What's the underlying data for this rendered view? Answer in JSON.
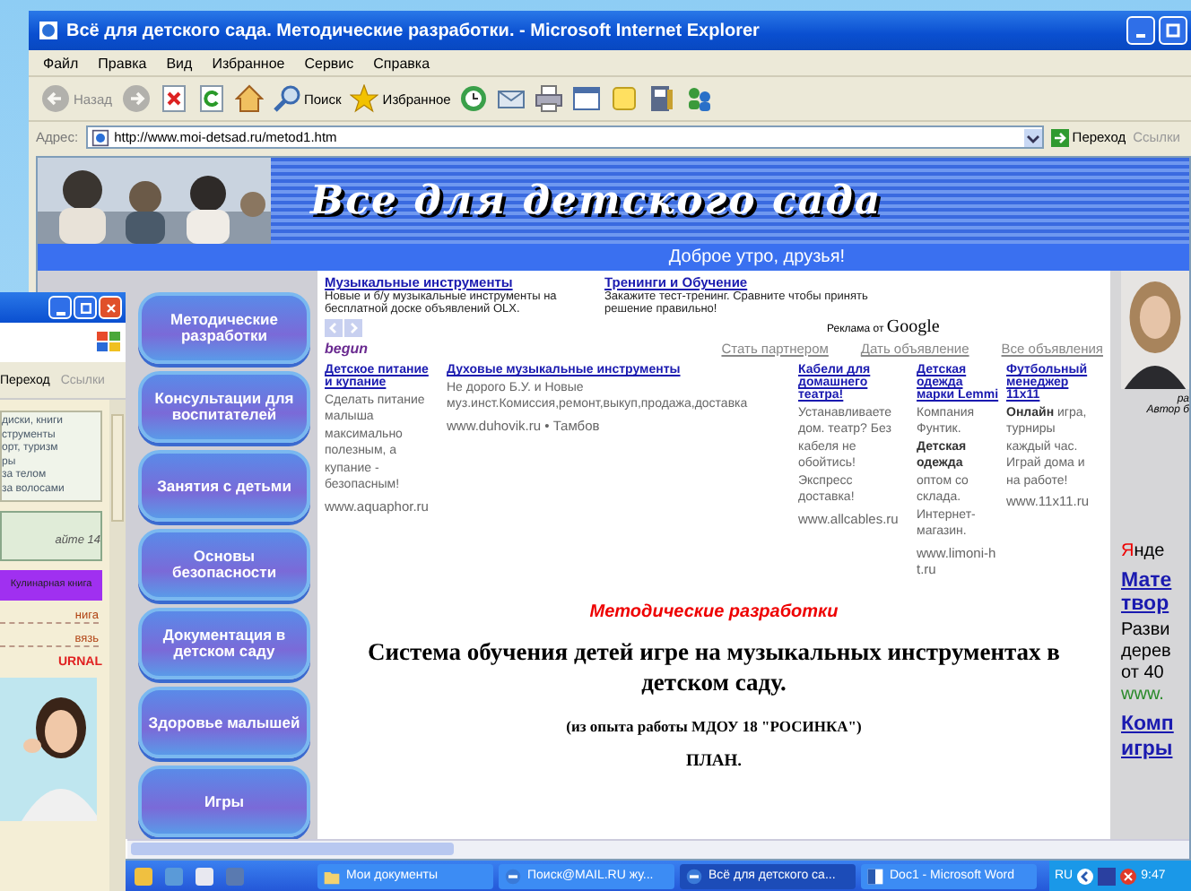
{
  "main_window": {
    "title": "Всё для детского сада. Методические разработки. - Microsoft Internet Explorer",
    "menu": [
      "Файл",
      "Правка",
      "Вид",
      "Избранное",
      "Сервис",
      "Справка"
    ],
    "toolbar": [
      {
        "kind": "back",
        "label": "Назад",
        "disabled": true
      },
      {
        "kind": "forward",
        "disabled": true
      },
      {
        "kind": "stop",
        "disabled": false
      },
      {
        "kind": "refresh",
        "disabled": false
      },
      {
        "kind": "home",
        "disabled": false
      },
      {
        "kind": "search",
        "label": "Поиск",
        "disabled": false
      },
      {
        "kind": "favorites",
        "label": "Избранное",
        "disabled": false
      },
      {
        "kind": "history",
        "disabled": false
      },
      {
        "kind": "mail",
        "disabled": false
      },
      {
        "kind": "print",
        "disabled": false
      },
      {
        "kind": "edit",
        "disabled": false
      },
      {
        "kind": "notes",
        "disabled": false
      },
      {
        "kind": "research",
        "disabled": false
      },
      {
        "kind": "messenger",
        "disabled": false
      }
    ],
    "address": {
      "label": "Адрес:",
      "value": "http://www.moi-detsad.ru/metod1.htm",
      "go": "Переход",
      "links": "Ссылки"
    },
    "page": {
      "banner_title": "Все для детского сада",
      "greeting": "Доброе утро, друзья!",
      "nav": [
        "Методические разработки",
        "Консультации для воспитателей",
        "Занятия с детьми",
        "Основы безопасности",
        "Документация в детском саду",
        "Здоровье малышей",
        "Игры"
      ],
      "top_ads": [
        {
          "title": "Музыкальные инструменты",
          "text": "Новые и б/у музыкальные инструменты на бесплатной доске объявлений OLX."
        },
        {
          "title": "Тренинги и Обучение",
          "text": "Закажите тест-тренинг. Сравните чтобы принять решение правильно!"
        }
      ],
      "ads_by": "Реклама от",
      "ads_brand": "Google",
      "begun": "begun",
      "ad_links": [
        "Стать партнером",
        "Дать объявление",
        "Все объявления"
      ],
      "ads": [
        {
          "title": "Детское питание и купание",
          "text": "Сделать питание малыша максимально полезным, а купание - безопасным!",
          "url": "www.aquaphor.ru"
        },
        {
          "title": "Духовые музыкальные инструменты",
          "text": "Не дорого Б.У. и Новые муз.инст.Комиссия,ремонт,выкуп,продажа,доставка",
          "url": "www.duhovik.ru • Тамбов"
        },
        {
          "title": "Кабели для домашнего театра!",
          "text": "Устанавливаете дом. театр? Без кабеля не обойтись! Экспресс доставка!",
          "url": "www.allcables.ru"
        },
        {
          "title": "Детская одежда марки Lemmi",
          "text": "Компания Фунтик. **Детская одежда** оптом со склада. Интернет-магазин.",
          "url": "www.limoni-ht.ru"
        },
        {
          "title": "Футбольный менеджер 11x11",
          "text": "**Онлайн** игра, турниры каждый час. Играй дома и на работе!",
          "url": "www.11x11.ru"
        }
      ],
      "section_title": "Методические разработки",
      "heading": "Система обучения детей игре на музыкальных инструментах в детском саду.",
      "subtitle": "(из опыта работы МДОУ 18 \"РОСИНКА\")",
      "plan": "ПЛАН.",
      "right_sidebar": {
        "caption": [
          "ра",
          "Автор б"
        ],
        "yandex": {
          "first": "Я",
          "rest": "нде"
        },
        "ads": [
          {
            "title_lines": [
              "Мате",
              "твор"
            ],
            "text_lines": [
              "Разви",
              "дерев",
              "от 40"
            ],
            "url": "www."
          },
          {
            "title_lines": [
              "Комп",
              "игры"
            ]
          }
        ]
      }
    }
  },
  "left_window": {
    "go": "Переход",
    "links": "Ссылки",
    "box_lines": [
      "диски, книги",
      "струменты",
      "орт, туризм",
      "ры",
      "за телом",
      "за волосами"
    ],
    "box2": "айте 14",
    "button": "Кулинарная книга",
    "link_list": [
      "нига",
      "вязь"
    ],
    "banner": "URNAL"
  },
  "taskbar": {
    "tasks": [
      {
        "label": "Мои документы",
        "kind": "folder",
        "selected": false
      },
      {
        "label": "Поиск@MAIL.RU жу...",
        "kind": "ie",
        "selected": false
      },
      {
        "label": "Всё для детского са...",
        "kind": "ie",
        "selected": true
      },
      {
        "label": "Doc1 - Microsoft Word",
        "kind": "word",
        "selected": false
      }
    ],
    "lang": "RU",
    "clock": "9:47"
  }
}
